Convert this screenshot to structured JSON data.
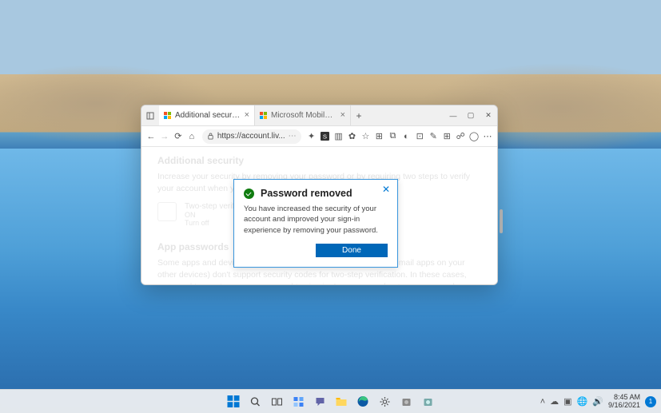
{
  "tabs": [
    {
      "label": "Additional security options",
      "active": true
    },
    {
      "label": "Microsoft Mobile Phone Authen",
      "active": false
    }
  ],
  "url": "https://account.liv...",
  "window_controls": {
    "min": "—",
    "max": "▢",
    "close": "✕"
  },
  "page": {
    "h1": "Additional security",
    "p1": "Increase your security by removing your password or by requiring two steps to verify your account when you sign in. Learn more if it's right for...",
    "tile_title": "Two-step verification",
    "tile_state": "ON",
    "tile_action": "Turn off",
    "h2": "App passwords",
    "p2": "Some apps and devices (such as Xbox 360, Windows Phone, or mail apps on your other devices) don't support security codes for two-step verification. In these cases, you need to create an app password to sign in. Learn more about app passwords."
  },
  "dialog": {
    "title": "Password removed",
    "message": "You have increased the security of your account and improved your sign-in experience by removing your password.",
    "done": "Done"
  },
  "tray": {
    "time": "8:45 AM",
    "date": "9/16/2021",
    "notif_count": "1"
  }
}
